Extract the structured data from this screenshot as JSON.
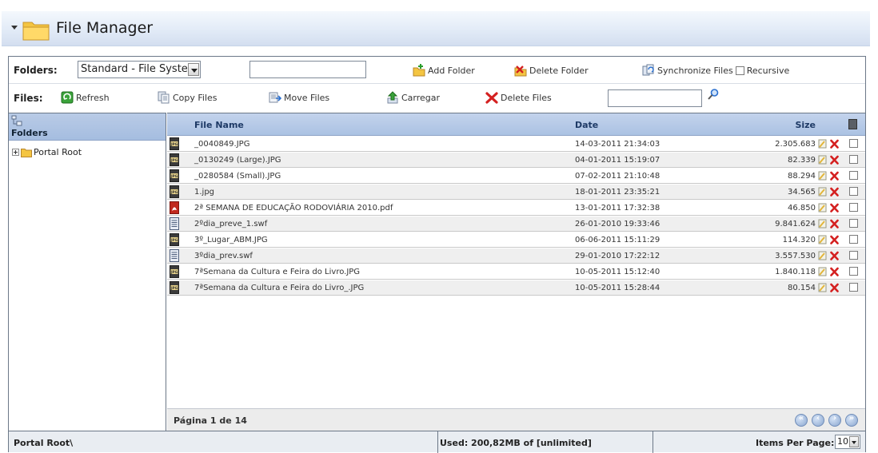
{
  "window": {
    "title": "File Manager"
  },
  "toolbar": {
    "folders_label": "Folders:",
    "folder_source": "Standard - File System",
    "folder_input": "",
    "add_folder": "Add Folder",
    "delete_folder": "Delete Folder",
    "synchronize_files": "Synchronize Files",
    "recursive": "Recursive",
    "files_label": "Files:",
    "refresh": "Refresh",
    "copy_files": "Copy Files",
    "move_files": "Move Files",
    "upload": "Carregar",
    "delete_files": "Delete Files",
    "search_input": ""
  },
  "tree": {
    "header": "Folders",
    "root": "Portal Root"
  },
  "grid": {
    "columns": {
      "name": "File Name",
      "date": "Date",
      "size": "Size"
    },
    "rows": [
      {
        "icon": "jpg-file-icon",
        "name": "_0040849.JPG",
        "date": "14-03-2011 21:34:03",
        "size": "2.305.683"
      },
      {
        "icon": "jpg-file-icon",
        "name": "_0130249 (Large).JPG",
        "date": "04-01-2011 15:19:07",
        "size": "82.339"
      },
      {
        "icon": "jpg-file-icon",
        "name": "_0280584 (Small).JPG",
        "date": "07-02-2011 21:10:48",
        "size": "88.294"
      },
      {
        "icon": "jpg-file-icon",
        "name": "1.jpg",
        "date": "18-01-2011 23:35:21",
        "size": "34.565"
      },
      {
        "icon": "pdf-file-icon",
        "name": "2ª SEMANA DE EDUCAÇÃO RODOVIÁRIA 2010.pdf",
        "date": "13-01-2011 17:32:38",
        "size": "46.850"
      },
      {
        "icon": "generic-file-icon",
        "name": "2ºdia_preve_1.swf",
        "date": "26-01-2010 19:33:46",
        "size": "9.841.624"
      },
      {
        "icon": "jpg-file-icon",
        "name": "3º_Lugar_ABM.JPG",
        "date": "06-06-2011 15:11:29",
        "size": "114.320"
      },
      {
        "icon": "generic-file-icon",
        "name": "3ºdia_prev.swf",
        "date": "29-01-2010 17:22:12",
        "size": "3.557.530"
      },
      {
        "icon": "jpg-file-icon",
        "name": "7ªSemana da Cultura e Feira do Livro.JPG",
        "date": "10-05-2011 15:12:40",
        "size": "1.840.118"
      },
      {
        "icon": "jpg-file-icon",
        "name": "7ªSemana da Cultura e Feira do Livro_.JPG",
        "date": "10-05-2011 15:28:44",
        "size": "80.154"
      }
    ]
  },
  "pager": {
    "text": "Página 1 de 14"
  },
  "status": {
    "path": "Portal Root\\",
    "usage": "Used: 200,82MB of [unlimited]",
    "items_per_page_label": "Items Per Page:",
    "items_per_page": "10"
  }
}
